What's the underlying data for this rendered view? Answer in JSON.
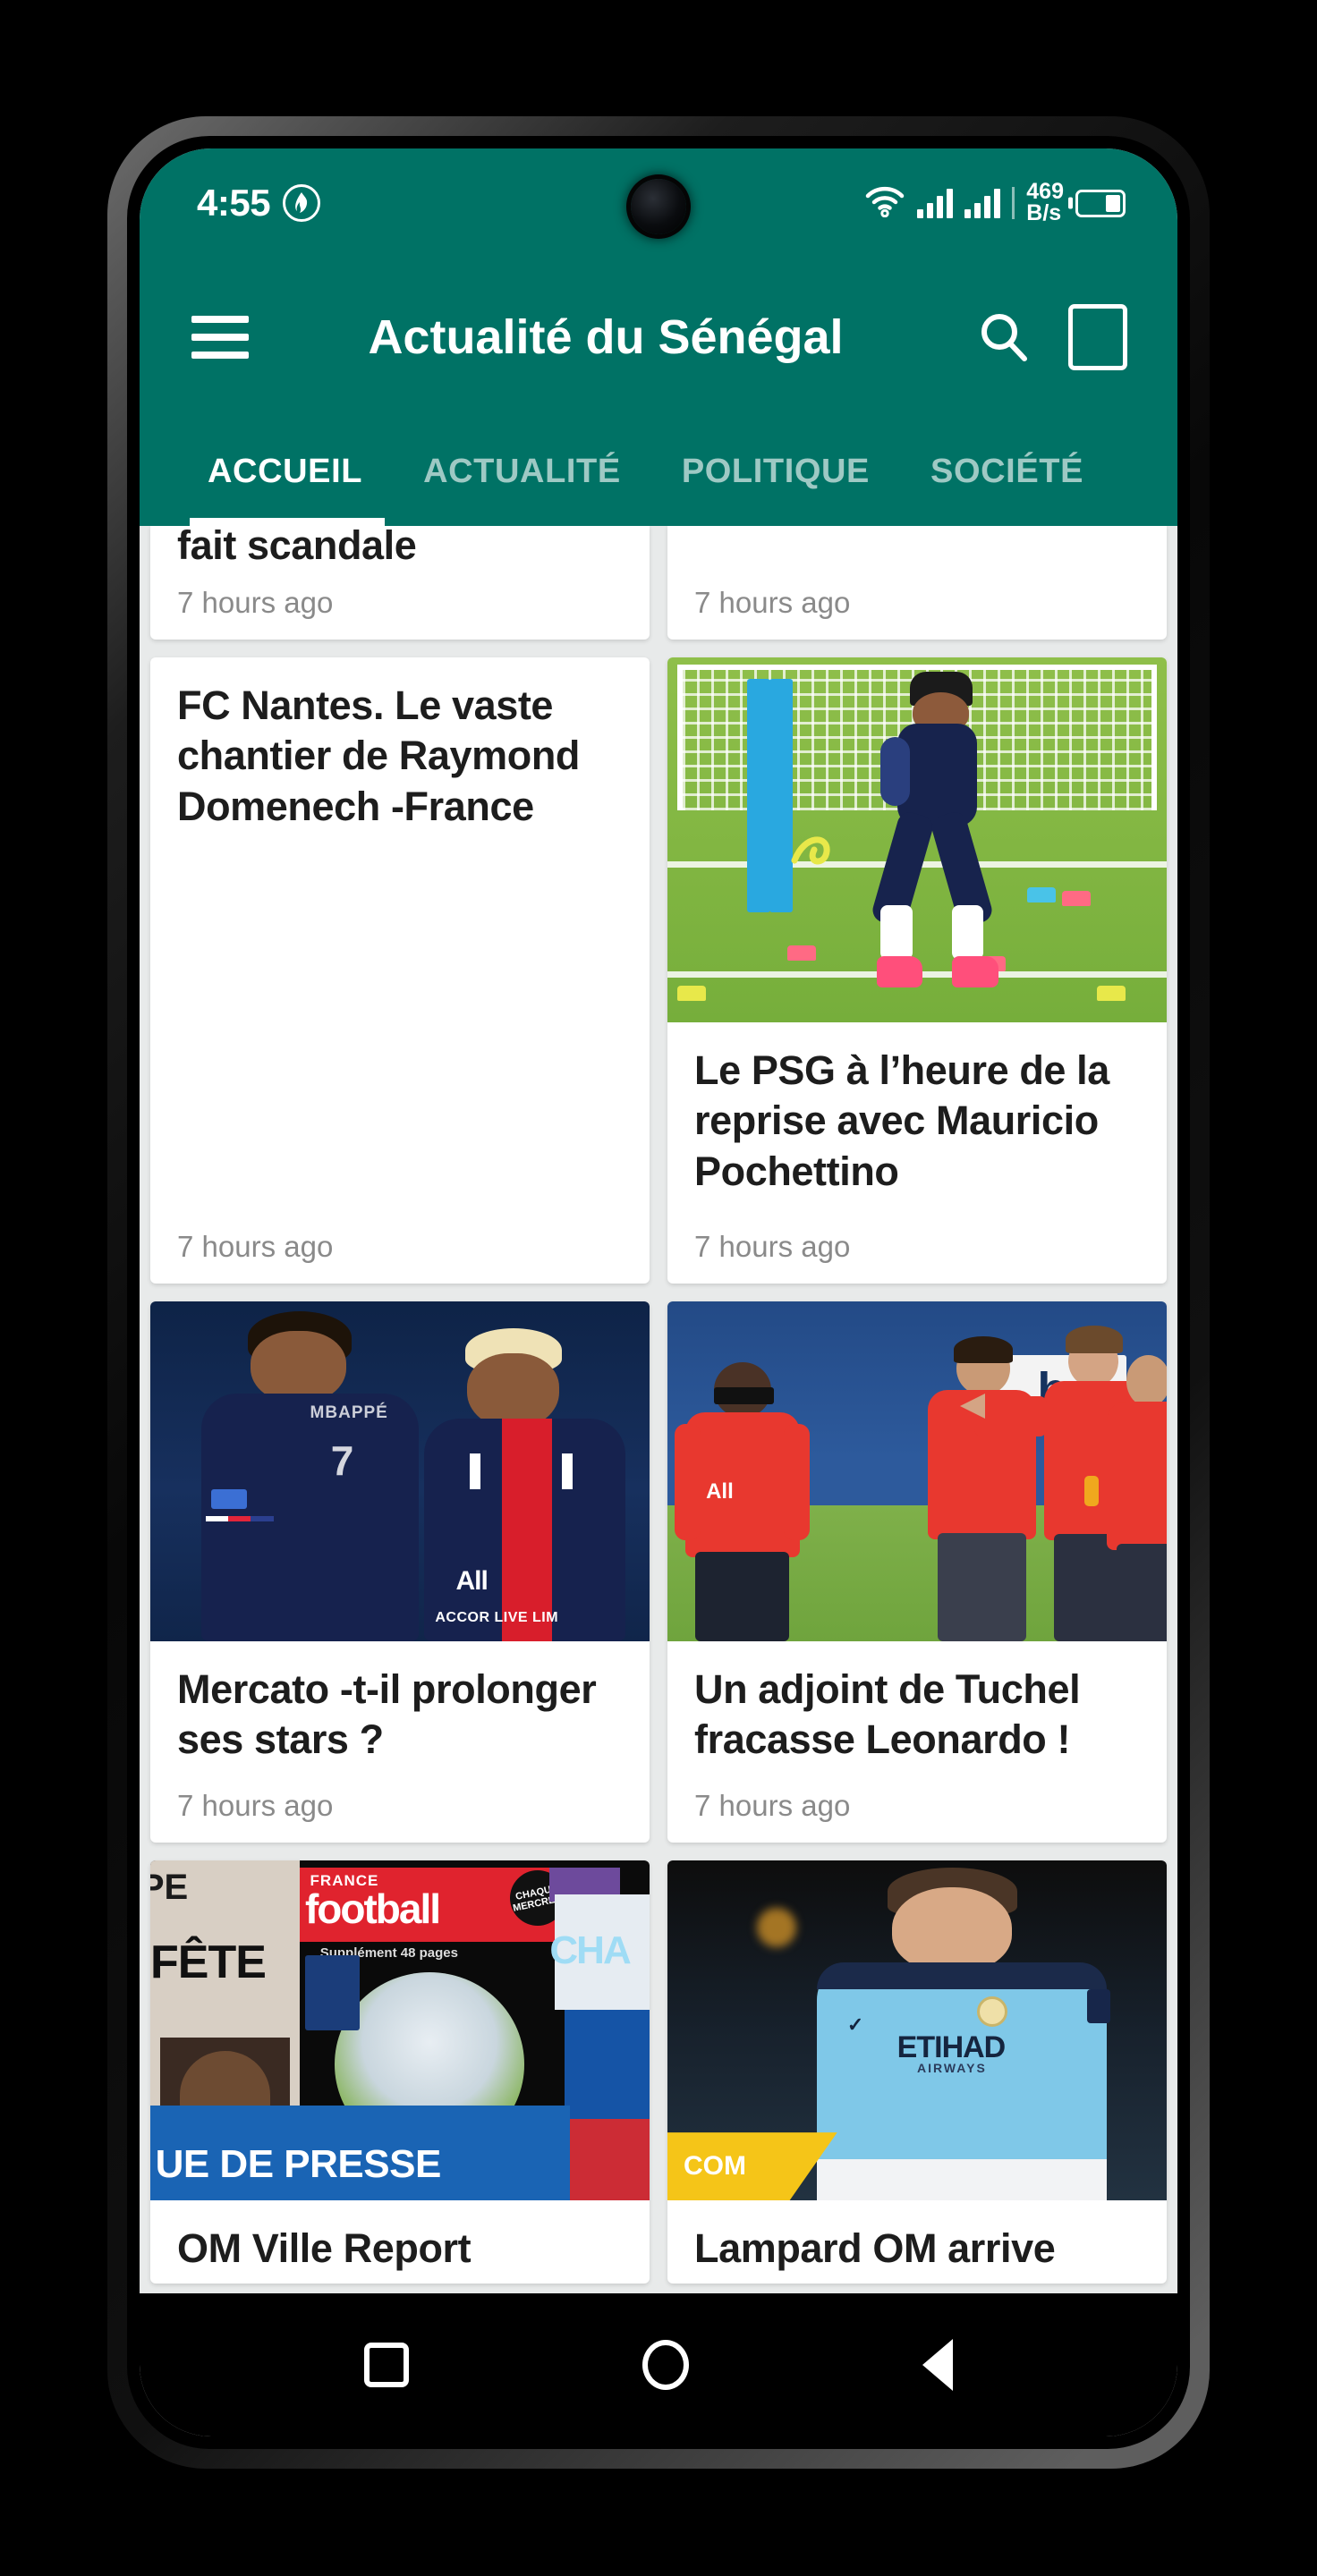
{
  "status_bar": {
    "time": "4:55",
    "badge_icon": "flame-badge-icon",
    "wifi_icon": "wifi-icon",
    "signal_icon_1": "signal-bars-icon",
    "signal_icon_2": "signal-bars-icon",
    "network_speed_value": "469",
    "network_speed_unit": "B/s",
    "battery_icon": "battery-icon"
  },
  "app_bar": {
    "menu_icon": "hamburger-menu-icon",
    "title": "Actualité du Sénégal",
    "search_icon": "search-icon",
    "box_icon": "square-box-icon"
  },
  "tabs": {
    "items": [
      {
        "label": "ACCUEIL",
        "active": true
      },
      {
        "label": "ACTUALITÉ",
        "active": false
      },
      {
        "label": "POLITIQUE",
        "active": false
      },
      {
        "label": "SOCIÉTÉ",
        "active": false
      }
    ]
  },
  "feed": {
    "rows": [
      {
        "cards": [
          {
            "title": "fait scandale",
            "time": "7 hours ago",
            "image": "none",
            "partial": true
          },
          {
            "title": "",
            "time": "7 hours ago",
            "image": "none",
            "partial": true
          }
        ]
      },
      {
        "cards": [
          {
            "title": "FC Nantes. Le vaste chantier de Raymond Domenech -France",
            "time": "7 hours ago",
            "image": "none"
          },
          {
            "title": "Le PSG à l’heure de la reprise avec Mauricio Pochettino",
            "time": "7 hours ago",
            "image": "psg-training-photo"
          }
        ]
      },
      {
        "cards": [
          {
            "title": "Mercato -t-il prolonger ses stars ?",
            "time": "7 hours ago",
            "image": "mbappe-neymar-photo"
          },
          {
            "title": "Un adjoint de Tuchel fracasse Leonardo !",
            "time": "7 hours ago",
            "image": "tuchel-staff-photo"
          }
        ]
      },
      {
        "cards": [
          {
            "title": "OM Ville Report",
            "time": "",
            "image": "revue-de-presse-collage",
            "partial_bottom": true
          },
          {
            "title": "Lampard OM arrive",
            "time": "",
            "image": "lampard-photo",
            "partial_bottom": true
          }
        ]
      }
    ]
  },
  "collage_text": {
    "france": "FRANCE",
    "football": "football",
    "supplement": "Supplément 48 pages",
    "chaque_mercredi": "CHAQUE MERCREDI EN KIOSQUE",
    "fete": "FÊTE",
    "cha": "CHA",
    "presse_band": "UE DE PRESSE"
  },
  "lampard_card": {
    "tag": "COM"
  },
  "nav_bar": {
    "recents_icon": "recents-square-icon",
    "home_icon": "home-circle-icon",
    "back_icon": "back-triangle-icon"
  },
  "colors": {
    "brand_teal": "#007265",
    "page_background": "#e8eaea",
    "card_background": "#ffffff",
    "title_text": "#1d1d1d",
    "time_text": "#8a8a8a",
    "nav_background": "#000000"
  }
}
